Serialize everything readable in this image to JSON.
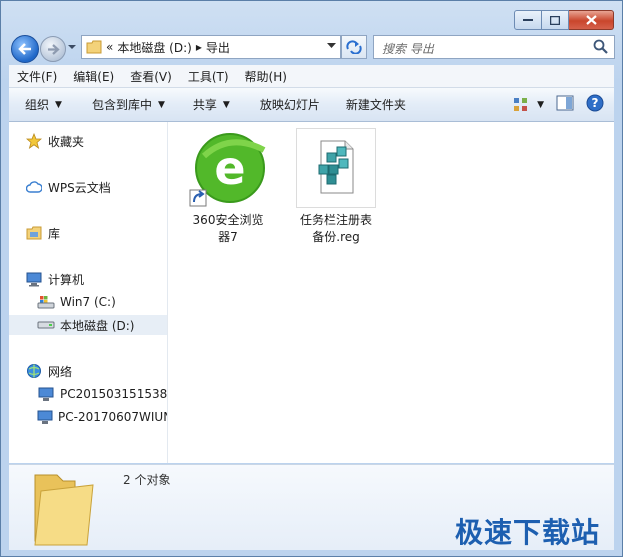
{
  "window": {
    "breadcrumb": {
      "parts": [
        "«",
        "本地磁盘 (D:)",
        "▸",
        "导出"
      ]
    },
    "search": {
      "placeholder": "搜索 导出"
    }
  },
  "menubar": [
    "文件(F)",
    "编辑(E)",
    "查看(V)",
    "工具(T)",
    "帮助(H)"
  ],
  "toolbar": {
    "organize": "组织",
    "include": "包含到库中",
    "share": "共享",
    "slideshow": "放映幻灯片",
    "newfolder": "新建文件夹"
  },
  "nav": {
    "favorites": "收藏夹",
    "wps": "WPS云文档",
    "library": "库",
    "computer": "计算机",
    "win7": "Win7 (C:)",
    "localdisk": "本地磁盘 (D:)",
    "network": "网络",
    "pc1": "PC201503151538",
    "pc2": "PC-20170607WIUN"
  },
  "files": [
    {
      "name": "360安全浏览器7",
      "line1": "360安全浏览",
      "line2": "器7"
    },
    {
      "name": "任务栏注册表备份.reg",
      "line1": "任务栏注册表",
      "line2": "备份.reg"
    }
  ],
  "details": {
    "count": "2 个对象"
  },
  "watermark": "极速下载站",
  "colors": {
    "accent": "#1d5fb0",
    "ie_green": "#4caf23"
  }
}
